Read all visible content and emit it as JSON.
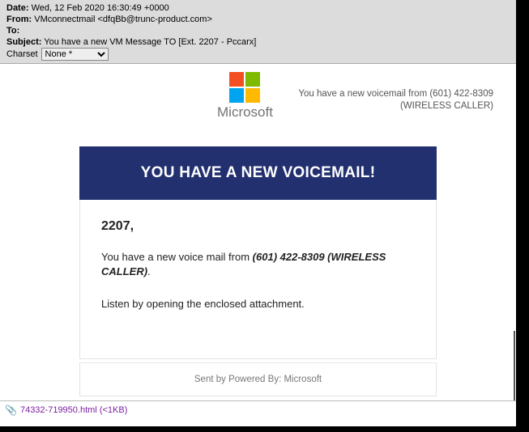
{
  "headers": {
    "date_label": "Date:",
    "date_value": "Wed, 12 Feb 2020 16:30:49 +0000",
    "from_label": "From:",
    "from_value": "VMconnectmail <dfqBb@trunc-product.com>",
    "to_label": "To:",
    "to_value": "",
    "subject_label": "Subject:",
    "subject_value": "You have a new VM Message TO [Ext. 2207 - Pccarx]",
    "charset_label": "Charset",
    "charset_value": "None *"
  },
  "brand": {
    "name": "Microsoft",
    "vm_line1": "You have a new voicemail from (601) 422-8309",
    "vm_line2": "(WIRELESS CALLER)"
  },
  "banner": {
    "title": "YOU HAVE A NEW VOICEMAIL!"
  },
  "card": {
    "greeting": "2207,",
    "line1_pre": "You have a new voice mail from ",
    "line1_bold": "(601) 422-8309 (WIRELESS CALLER)",
    "line1_post": ".",
    "line2": "Listen by opening the enclosed attachment.",
    "footer": "Sent by Powered By: Microsoft"
  },
  "attachment": {
    "filename": "74332-719950.html",
    "size": "(<1KB)"
  }
}
